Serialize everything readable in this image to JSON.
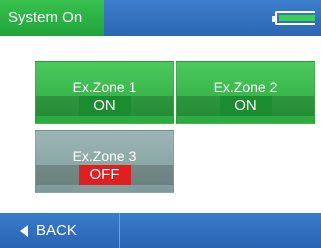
{
  "header": {
    "status": "System On",
    "battery_icon": "battery-icon"
  },
  "zones": [
    {
      "name": "Ex.Zone 1",
      "state": "ON"
    },
    {
      "name": "Ex.Zone 2",
      "state": "ON"
    },
    {
      "name": "Ex.Zone 3",
      "state": "OFF"
    }
  ],
  "footer": {
    "back_label": "BACK",
    "back_icon": "back-arrow-icon"
  },
  "colors": {
    "on": "#2aa93f",
    "off_badge": "#e02020",
    "bar": "#2b66b3"
  }
}
